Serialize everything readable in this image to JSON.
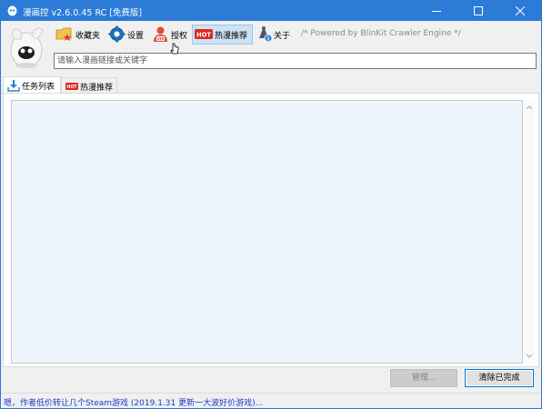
{
  "window": {
    "title": "漫画控 v2.6.0.45 RC [免费版]",
    "accent_color": "#2b7bd7",
    "icons": {
      "app": "app-logo-icon",
      "minimize": "minimize-icon",
      "maximize": "maximize-icon",
      "close": "close-icon"
    }
  },
  "toolbar": {
    "items": [
      {
        "label": "收藏夹",
        "icon": "folder-star-icon"
      },
      {
        "label": "设置",
        "icon": "gear-icon"
      },
      {
        "label": "授权",
        "icon": "vip-user-icon"
      },
      {
        "label": "热漫推荐",
        "icon": "hot-badge-icon",
        "badge": "HOT"
      },
      {
        "label": "关于",
        "icon": "info-figure-icon"
      }
    ],
    "powered_by": "/* Powered by BlinKit Crawler Engine */"
  },
  "search": {
    "placeholder": "请输入漫画链接或关键字",
    "value": ""
  },
  "tabs": [
    {
      "label": "任务列表",
      "icon": "download-icon",
      "active": true
    },
    {
      "label": "热漫推荐",
      "icon": "hot-badge-icon",
      "badge": "HOT",
      "active": false
    }
  ],
  "actions": {
    "manage_label": "管理...",
    "clear_label": "清除已完成"
  },
  "status": {
    "text": "嗯，作者低价转让几个Steam游戏 (2019.1.31 更新一大波好价游戏)..."
  }
}
